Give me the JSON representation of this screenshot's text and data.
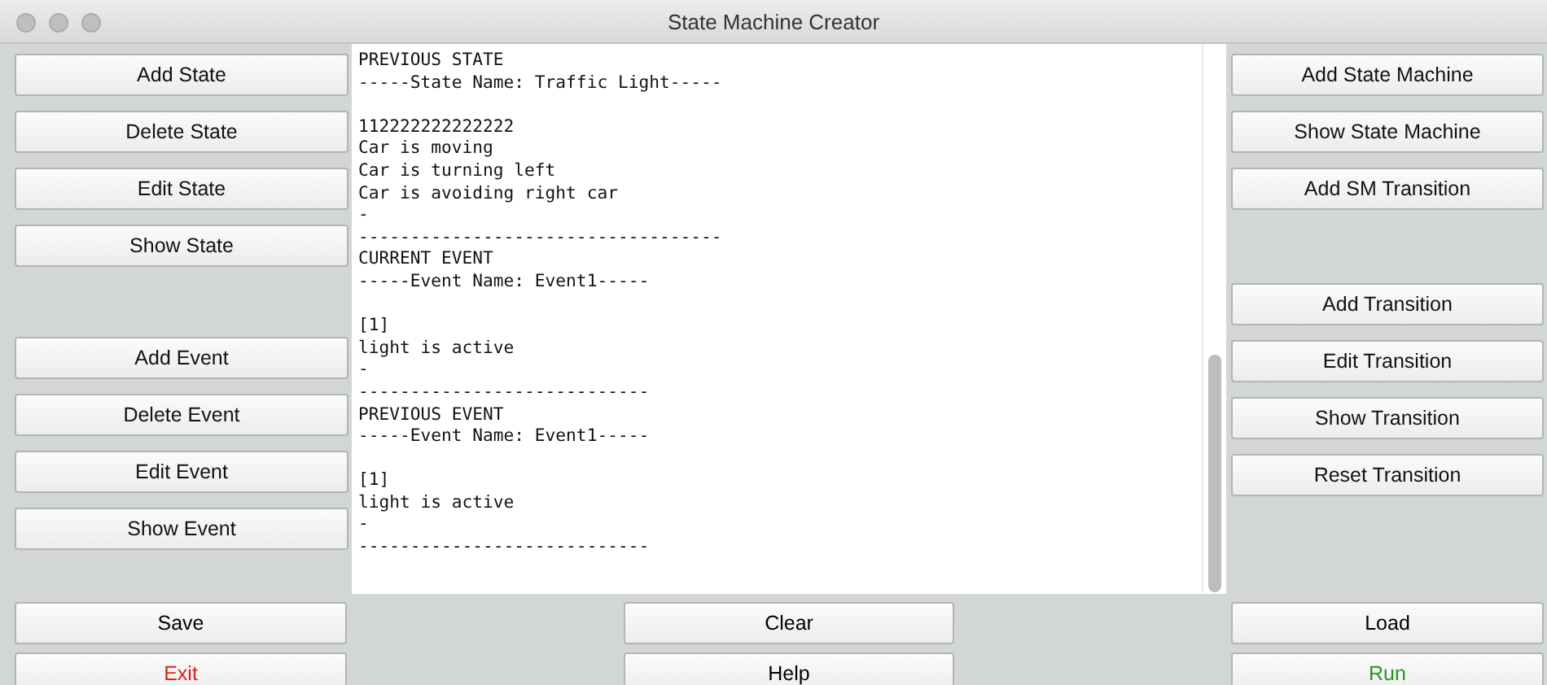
{
  "window": {
    "title": "State Machine Creator"
  },
  "left_groups": [
    [
      "Add State",
      "Delete State",
      "Edit State",
      "Show State"
    ],
    [
      "Add Event",
      "Delete Event",
      "Edit Event",
      "Show Event"
    ]
  ],
  "right_groups": [
    [
      "Add State Machine",
      "Show State Machine",
      "Add SM Transition"
    ],
    [
      "Add Transition",
      "Edit Transition",
      "Show Transition",
      "Reset Transition"
    ]
  ],
  "output_blocks": [
    [
      "PREVIOUS STATE",
      "-----State Name: Traffic Light-----"
    ],
    [
      "112222222222222",
      "Car is moving",
      "Car is turning left",
      "Car is avoiding right car",
      "-",
      "-----------------------------------",
      "CURRENT EVENT",
      "-----Event Name: Event1-----"
    ],
    [
      "[1]",
      "light is active",
      "-",
      "----------------------------",
      "PREVIOUS EVENT",
      "-----Event Name: Event1-----"
    ],
    [
      "[1]",
      "light is active",
      "-",
      "----------------------------"
    ]
  ],
  "bottom_columns": [
    [
      {
        "label": "Save",
        "color": "#000000"
      },
      {
        "label": "Exit",
        "color": "#e0201c"
      }
    ],
    [
      {
        "label": "Clear",
        "color": "#000000"
      },
      {
        "label": "Help",
        "color": "#000000"
      }
    ],
    [
      {
        "label": "Load",
        "color": "#000000"
      },
      {
        "label": "Run",
        "color": "#1f9a1f"
      }
    ]
  ]
}
